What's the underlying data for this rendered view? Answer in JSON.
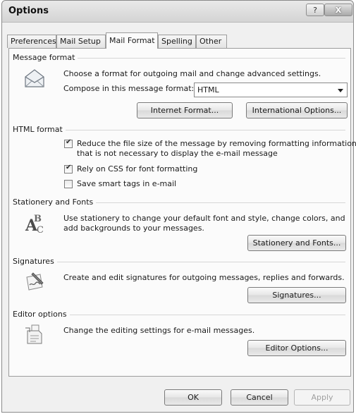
{
  "window": {
    "title": "Options",
    "help_label": "?",
    "close_label": "X"
  },
  "tabs": [
    {
      "label": "Preferences",
      "active": false
    },
    {
      "label": "Mail Setup",
      "active": false
    },
    {
      "label": "Mail Format",
      "active": true
    },
    {
      "label": "Spelling",
      "active": false
    },
    {
      "label": "Other",
      "active": false
    }
  ],
  "message_format": {
    "title": "Message format",
    "description": "Choose a format for outgoing mail and change advanced settings.",
    "compose_label": "Compose in this message format:",
    "compose_value": "HTML",
    "internet_format_button": "Internet Format...",
    "international_options_button": "International Options..."
  },
  "html_format": {
    "title": "HTML format",
    "options": [
      {
        "line1": "Reduce the file size of the message by removing formatting information",
        "line2": "that is not necessary to display the e-mail message",
        "checked": true
      },
      {
        "line1": "Rely on CSS for font formatting",
        "checked": true
      },
      {
        "line1": "Save smart tags in e-mail",
        "checked": false
      }
    ]
  },
  "stationery": {
    "title": "Stationery and Fonts",
    "line1": "Use stationery to change your default font and style, change colors, and",
    "line2": "add backgrounds to your messages.",
    "button": "Stationery and Fonts..."
  },
  "signatures": {
    "title": "Signatures",
    "description": "Create and edit signatures for outgoing messages, replies and forwards.",
    "button": "Signatures..."
  },
  "editor_options": {
    "title": "Editor options",
    "description": "Change the editing settings for e-mail messages.",
    "button": "Editor Options..."
  },
  "footer": {
    "ok": "OK",
    "cancel": "Cancel",
    "apply": "Apply"
  }
}
